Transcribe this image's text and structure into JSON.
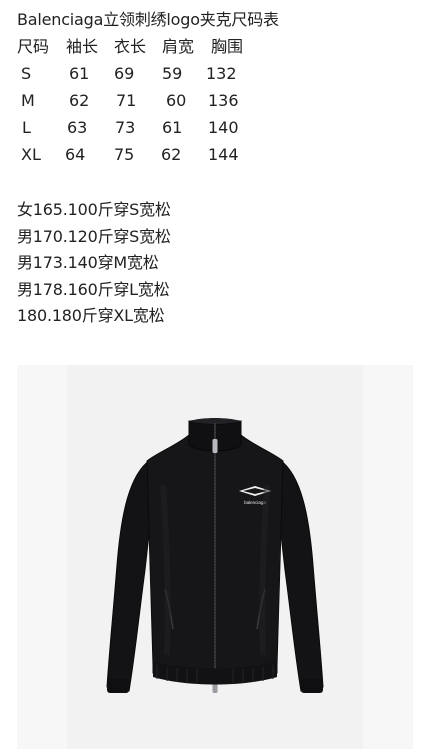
{
  "title": "Balenciaga立领刺绣logo夹克尺码表",
  "size_table": {
    "headers": [
      "尺码",
      "袖长",
      "衣长",
      "肩宽",
      "胸围"
    ],
    "rows": [
      [
        "S",
        "61",
        "69",
        "59",
        "132"
      ],
      [
        "M",
        "62",
        "71",
        "60",
        "136"
      ],
      [
        "L",
        "63",
        "73",
        "61",
        "140"
      ],
      [
        "XL",
        "64",
        "75",
        "62",
        "144"
      ]
    ]
  },
  "fit_notes": [
    "女165.100斤穿S宽松",
    "男170.120斤穿S宽松",
    "男173.140穿M宽松",
    "男178.160斤穿L宽松",
    "180.180斤穿XL宽松"
  ],
  "product_image": {
    "subject": "black zip-up track jacket with stand collar and embroidered chest logo",
    "logo_text": "balenciaga",
    "jacket_color": "#141416",
    "background_color": "#f2f2f2"
  }
}
